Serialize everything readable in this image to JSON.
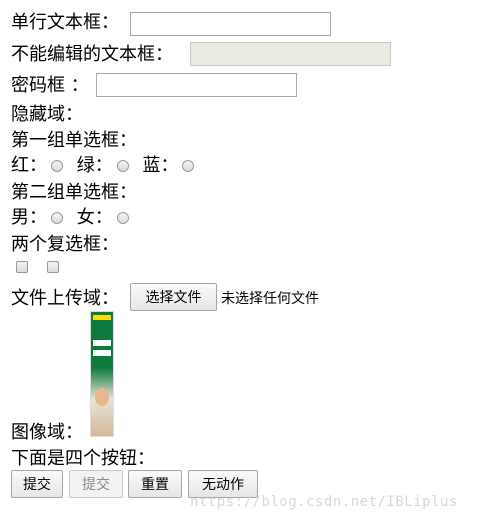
{
  "form": {
    "text_field_label": "单行文本框：",
    "text_field_value": "",
    "readonly_field_label": "不能编辑的文本框：",
    "readonly_field_value": "",
    "password_field_label": "密码框 ：",
    "password_field_value": "",
    "hidden_label": "隐藏域：",
    "radio_group1_title": "第一组单选框：",
    "radio_red": "红：",
    "radio_green": "绿：",
    "radio_blue": "蓝：",
    "radio_group2_title": "第二组单选框：",
    "radio_male": "男：",
    "radio_female": "女：",
    "checkbox_title": "两个复选框：",
    "upload_label": "文件上传域：",
    "upload_button": "选择文件",
    "upload_status": "未选择任何文件",
    "image_label": "图像域：",
    "buttons_title": "下面是四个按钮：",
    "buttons": {
      "submit": "提交",
      "submit_disabled": "提交",
      "reset": "重置",
      "no_action": "无动作"
    }
  },
  "watermark": "https://blog.csdn.net/IBLiplus",
  "colors": {
    "disabled_field_bg": "#ebebe4",
    "ad_green": "#0d7a3e"
  }
}
